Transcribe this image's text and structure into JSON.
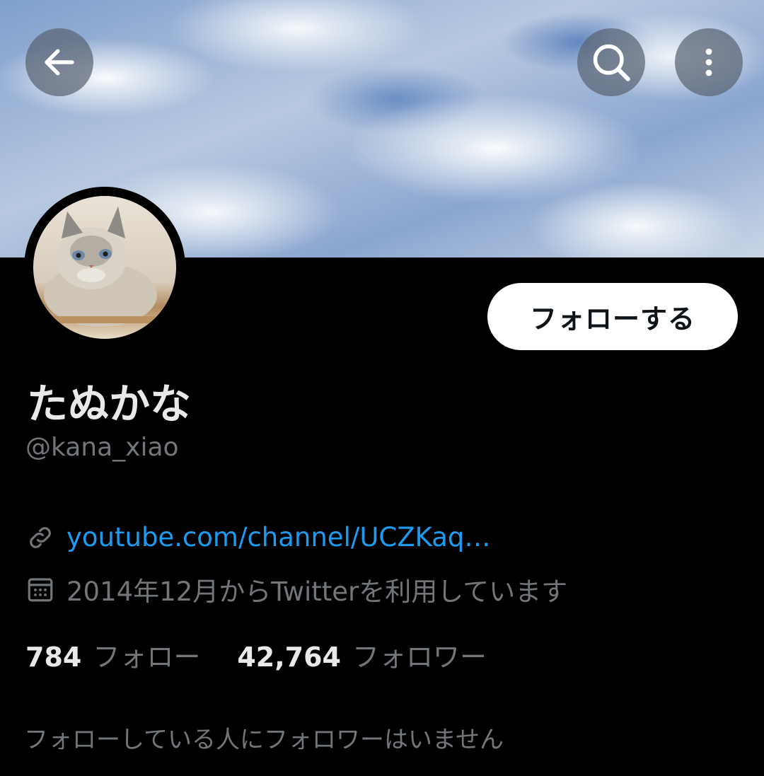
{
  "header": {
    "back_icon": "arrow-left-icon",
    "search_icon": "search-icon",
    "more_icon": "more-vertical-icon"
  },
  "profile": {
    "display_name": "たぬかな",
    "handle": "@kana_xiao",
    "follow_button_label": "フォローする",
    "link_icon": "link-icon",
    "link_text": "youtube.com/channel/UCZKaq…",
    "calendar_icon": "calendar-icon",
    "joined_text": "2014年12月からTwitterを利用しています",
    "following_count": "784",
    "following_label": "フォロー",
    "followers_count": "42,764",
    "followers_label": "フォロワー",
    "mutual_followers_text": "フォローしている人にフォロワーはいません"
  },
  "colors": {
    "background": "#000000",
    "link": "#1d9bf0",
    "secondary_text": "#71767b",
    "primary_text": "#e7e9ea"
  }
}
